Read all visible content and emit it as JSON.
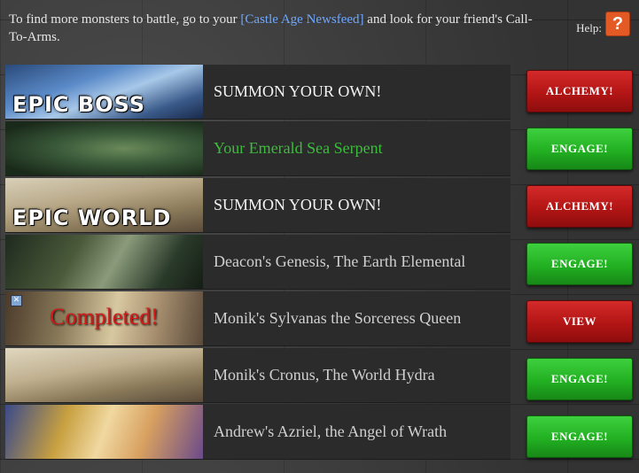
{
  "intro": {
    "before": "To find more monsters to battle, go to your ",
    "link": "[Castle Age Newsfeed]",
    "after": " and look for your friend's Call-To-Arms."
  },
  "help": {
    "label": "Help:",
    "icon": "?"
  },
  "rows": [
    {
      "name": "SUMMON YOUR OWN!",
      "thumb_label": "EPIC BOSS",
      "thumb_overlay": "",
      "button": "ALCHEMY!",
      "button_color": "red"
    },
    {
      "name": "Your Emerald Sea Serpent",
      "thumb_label": "",
      "thumb_overlay": "",
      "button": "ENGAGE!",
      "button_color": "green"
    },
    {
      "name": "SUMMON YOUR OWN!",
      "thumb_label": "EPIC WORLD",
      "thumb_overlay": "",
      "button": "ALCHEMY!",
      "button_color": "red"
    },
    {
      "name": "Deacon's Genesis, The Earth Elemental",
      "thumb_label": "",
      "thumb_overlay": "",
      "button": "ENGAGE!",
      "button_color": "green"
    },
    {
      "name": "Monik's Sylvanas the Sorceress Queen",
      "thumb_label": "",
      "thumb_overlay": "Completed!",
      "button": "VIEW",
      "button_color": "red"
    },
    {
      "name": "Monik's Cronus, The World Hydra",
      "thumb_label": "",
      "thumb_overlay": "",
      "button": "ENGAGE!",
      "button_color": "green"
    },
    {
      "name": "Andrew's Azriel, the Angel of Wrath",
      "thumb_label": "",
      "thumb_overlay": "",
      "button": "ENGAGE!",
      "button_color": "green"
    }
  ],
  "colors": {
    "red_button": "#b31515",
    "green_button": "#22b022",
    "own_monster_text": "#3dbb3d",
    "link": "#6fa8ff"
  }
}
